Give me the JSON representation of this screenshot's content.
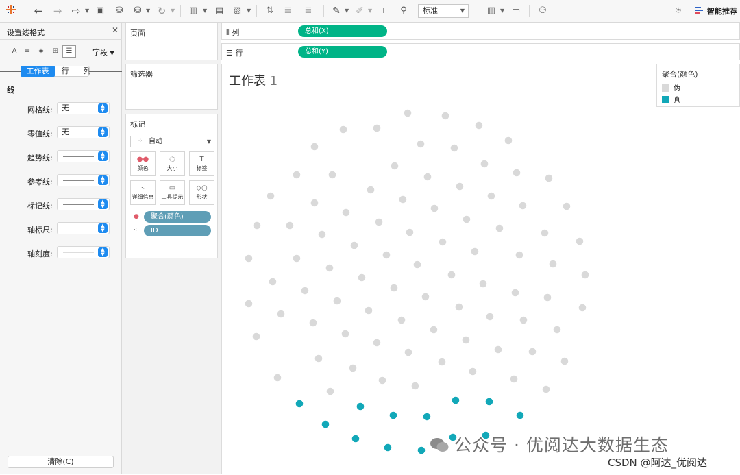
{
  "toolbar": {
    "fit_select": "标准",
    "smart_recommend": "智能推荐"
  },
  "format_panel": {
    "title": "设置线格式",
    "field_menu": "字段",
    "tabs": [
      "工作表",
      "行",
      "列"
    ],
    "active_tab": "工作表",
    "section": "线",
    "rows": [
      {
        "label": "网格线:",
        "value": "无"
      },
      {
        "label": "零值线:",
        "value": "无"
      },
      {
        "label": "趋势线:",
        "value": ""
      },
      {
        "label": "参考线:",
        "value": ""
      },
      {
        "label": "标记线:",
        "value": ""
      },
      {
        "label": "轴标尺:",
        "value": ""
      },
      {
        "label": "轴刻度:",
        "value": ""
      }
    ],
    "clear_button": "清除(C)"
  },
  "cards": {
    "pages_title": "页面",
    "filters_title": "筛选器",
    "marks_title": "标记",
    "mark_type": "自动",
    "mark_buttons": [
      "颜色",
      "大小",
      "标签",
      "详细信息",
      "工具提示",
      "形状"
    ],
    "pills": [
      "聚合(颜色)",
      "ID"
    ]
  },
  "shelves": {
    "columns_label": "列",
    "rows_label": "行",
    "columns_pill": "总和(X)",
    "rows_pill": "总和(Y)"
  },
  "sheet": {
    "title_word": "工作表",
    "title_num": "1"
  },
  "legend": {
    "title": "聚合(颜色)",
    "items": [
      {
        "label": "伪",
        "color": "#d9d9d9"
      },
      {
        "label": "真",
        "color": "#12a8b8"
      }
    ]
  },
  "chart_data": {
    "type": "scatter",
    "title": "工作表 1",
    "colors": {
      "false": "#d9d9d9",
      "true": "#12a8b8"
    },
    "series": [
      {
        "name": "伪",
        "points": [
          [
            594,
            164
          ],
          [
            649,
            168
          ],
          [
            549,
            186
          ],
          [
            500,
            188
          ],
          [
            698,
            182
          ],
          [
            458,
            213
          ],
          [
            613,
            209
          ],
          [
            662,
            215
          ],
          [
            741,
            204
          ],
          [
            432,
            254
          ],
          [
            484,
            254
          ],
          [
            575,
            241
          ],
          [
            623,
            257
          ],
          [
            706,
            238
          ],
          [
            753,
            251
          ],
          [
            800,
            259
          ],
          [
            394,
            285
          ],
          [
            458,
            295
          ],
          [
            540,
            276
          ],
          [
            587,
            290
          ],
          [
            670,
            271
          ],
          [
            716,
            285
          ],
          [
            762,
            299
          ],
          [
            826,
            300
          ],
          [
            374,
            328
          ],
          [
            422,
            328
          ],
          [
            504,
            309
          ],
          [
            552,
            323
          ],
          [
            633,
            303
          ],
          [
            680,
            319
          ],
          [
            728,
            332
          ],
          [
            794,
            339
          ],
          [
            362,
            376
          ],
          [
            432,
            376
          ],
          [
            469,
            341
          ],
          [
            516,
            357
          ],
          [
            597,
            338
          ],
          [
            645,
            352
          ],
          [
            692,
            366
          ],
          [
            757,
            371
          ],
          [
            845,
            351
          ],
          [
            397,
            410
          ],
          [
            480,
            390
          ],
          [
            563,
            371
          ],
          [
            608,
            385
          ],
          [
            658,
            400
          ],
          [
            806,
            384
          ],
          [
            853,
            400
          ],
          [
            362,
            442
          ],
          [
            444,
            423
          ],
          [
            527,
            404
          ],
          [
            574,
            419
          ],
          [
            620,
            432
          ],
          [
            704,
            413
          ],
          [
            751,
            426
          ],
          [
            409,
            457
          ],
          [
            491,
            438
          ],
          [
            537,
            452
          ],
          [
            585,
            466
          ],
          [
            632,
            480
          ],
          [
            669,
            447
          ],
          [
            714,
            461
          ],
          [
            798,
            433
          ],
          [
            849,
            448
          ],
          [
            373,
            490
          ],
          [
            456,
            470
          ],
          [
            503,
            486
          ],
          [
            549,
            499
          ],
          [
            595,
            513
          ],
          [
            679,
            495
          ],
          [
            726,
            509
          ],
          [
            763,
            466
          ],
          [
            812,
            480
          ],
          [
            404,
            550
          ],
          [
            464,
            522
          ],
          [
            514,
            536
          ],
          [
            557,
            554
          ],
          [
            605,
            562
          ],
          [
            644,
            527
          ],
          [
            689,
            541
          ],
          [
            749,
            552
          ],
          [
            796,
            567
          ],
          [
            776,
            512
          ],
          [
            823,
            526
          ],
          [
            481,
            570
          ]
        ]
      },
      {
        "name": "真",
        "points": [
          [
            436,
            588
          ],
          [
            474,
            618
          ],
          [
            525,
            592
          ],
          [
            518,
            639
          ],
          [
            573,
            605
          ],
          [
            565,
            652
          ],
          [
            622,
            607
          ],
          [
            614,
            656
          ],
          [
            664,
            583
          ],
          [
            660,
            637
          ],
          [
            713,
            585
          ],
          [
            708,
            634
          ],
          [
            758,
            605
          ]
        ]
      }
    ]
  }
}
